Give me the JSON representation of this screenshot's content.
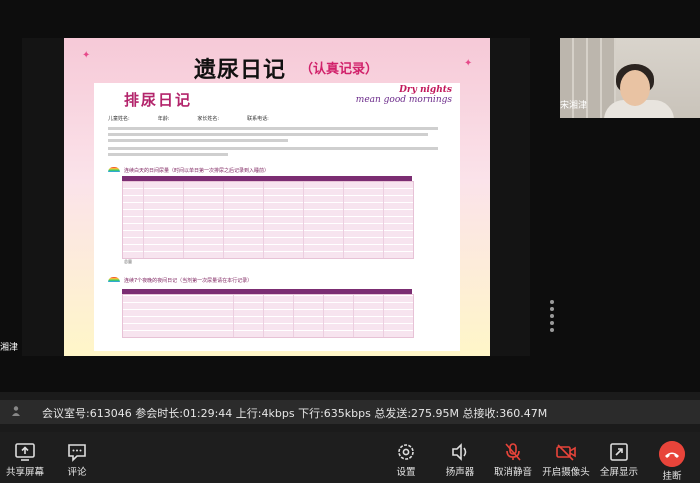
{
  "meeting": {
    "stats": "会议室号:613046   参会时长:01:29:44   上行:4kbps 下行:635kbps 总发送:275.95M 总接收:360.47M"
  },
  "participants": {
    "camera_name": "宋湘津",
    "left_name": "湘津"
  },
  "slide": {
    "title": "遗尿日记",
    "subtitle": "（认真记录）",
    "paper_title": "排尿日记",
    "dry_nights_line1": "Dry nights",
    "dry_nights_line2": "mean good mornings",
    "field_child": "儿童姓名:",
    "field_age": "年龄:",
    "field_parent": "家长姓名:",
    "field_phone": "联系电话:",
    "section1": "连续白天的日间尿量（时间以单日第一次排尿之后记录到入睡前）",
    "section2": "连续7个夜晚的夜间日记（当剂第一次尿量请在本行记录）",
    "table1_footer": "总量"
  },
  "toolbar": {
    "share_screen": "共享屏幕",
    "comment": "评论",
    "settings": "设置",
    "speaker": "扬声器",
    "unmute": "取消静音",
    "start_video": "开启摄像头",
    "fullscreen": "全屏显示",
    "hangup": "挂断"
  },
  "colors": {
    "hangup": "#e8443a",
    "mic_muted": "#e8443a",
    "slide_accent": "#b3246b"
  }
}
